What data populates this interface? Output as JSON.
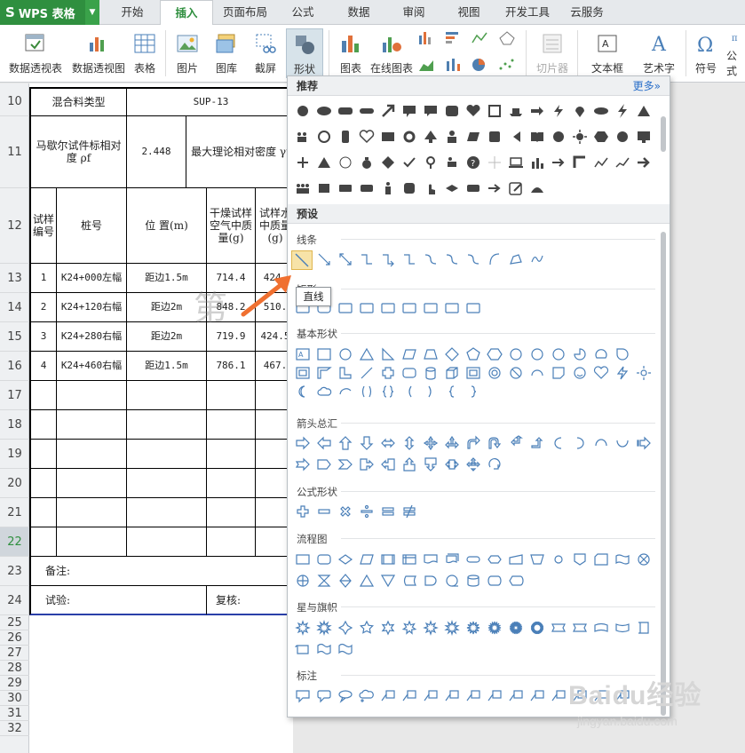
{
  "app": {
    "title": "WPS 表格"
  },
  "tabs": [
    {
      "label": "开始"
    },
    {
      "label": "插入"
    },
    {
      "label": "页面布局"
    },
    {
      "label": "公式"
    },
    {
      "label": "数据"
    },
    {
      "label": "审阅"
    },
    {
      "label": "视图"
    },
    {
      "label": "开发工具"
    },
    {
      "label": "云服务"
    }
  ],
  "active_tab": "插入",
  "ribbon": {
    "pivot_table": "数据透视表",
    "pivot_chart": "数据透视图",
    "table": "表格",
    "picture": "图片",
    "gallery": "图库",
    "screenshot": "截屏",
    "shapes": "形状",
    "chart": "图表",
    "online_chart": "在线图表",
    "slicer": "切片器",
    "textbox": "文本框",
    "wordart": "艺术字",
    "symbol": "符号",
    "formula": "公式"
  },
  "sheet": {
    "row_numbers": [
      "10",
      "11",
      "12",
      "13",
      "14",
      "15",
      "16",
      "17",
      "18",
      "19",
      "20",
      "21",
      "22",
      "23",
      "24",
      "25",
      "26",
      "27",
      "28",
      "29",
      "30",
      "31",
      "32"
    ],
    "selected_row": "22",
    "mix_type_label": "混合料类型",
    "mix_type_value": "SUP-13",
    "marshall_label": "马歇尔试件标相对度 ρf",
    "marshall_value": "2.448",
    "max_theory_label": "最大理论相对密度 γt",
    "col_sample_no": "试样编号",
    "col_pile_no": "桩号",
    "col_position": "位 置(m)",
    "col_dry_mass": "干燥试样空气中质量(g)",
    "col_water_mass": "试样水中质量(g)",
    "rows": [
      {
        "no": "1",
        "pile": "K24+000左幅",
        "pos": "距边1.5m",
        "dry": "714.4",
        "water": "424."
      },
      {
        "no": "2",
        "pile": "K24+120右幅",
        "pos": "距边2m",
        "dry": "848.2",
        "water": "510."
      },
      {
        "no": "3",
        "pile": "K24+280右幅",
        "pos": "距边2m",
        "dry": "719.9",
        "water": "424.5"
      },
      {
        "no": "4",
        "pile": "K24+460右幅",
        "pos": "距边1.5m",
        "dry": "786.1",
        "water": "467."
      }
    ],
    "remarks_label": "备注:",
    "test_label": "试验:",
    "review_label": "复核:"
  },
  "dropdown": {
    "recommended_header": "推荐",
    "more_link": "更多»",
    "presets_header": "预设",
    "categories": {
      "lines": "线条",
      "rectangles": "矩形",
      "basic": "基本形状",
      "arrows": "箭头总汇",
      "equation": "公式形状",
      "flowchart": "流程图",
      "stars": "星与旗帜",
      "callouts": "标注"
    },
    "tooltip": "直线"
  },
  "watermark": {
    "brand": "Baidu经验",
    "url": "jingyan.baidu.com"
  },
  "colors": {
    "wps_green": "#2f8f3f",
    "shape_blue": "#4a7fb8",
    "arrow_orange": "#f07030"
  }
}
